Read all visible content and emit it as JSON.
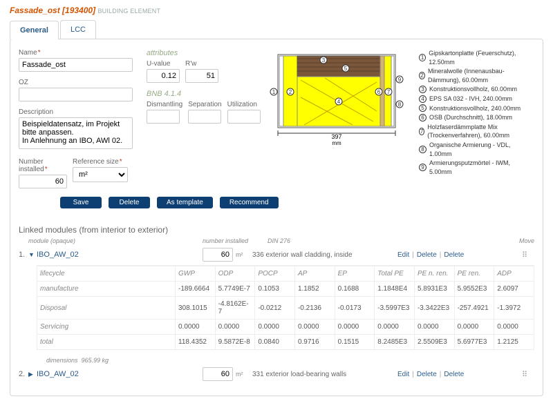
{
  "header": {
    "name": "Fassade_ost",
    "id": "[193400]",
    "type": "BUILDING ELEMENT"
  },
  "tabs": {
    "general": "General",
    "lcc": "LCC"
  },
  "form": {
    "name_label": "Name",
    "name_value": "Fassade_ost",
    "oz_label": "OZ",
    "oz_value": "",
    "desc_label": "Description",
    "desc_value": "Beispieldatensatz, im Projekt bitte anpassen.\nIn Anlehnung an IBO, AWl 02.",
    "num_label": "Number installed",
    "num_value": "60",
    "refsize_label": "Reference size",
    "refsize_value": "m²"
  },
  "attr": {
    "heading": "attributes",
    "uvalue_label": "U-value",
    "uvalue": "0.12",
    "rw_label": "R'w",
    "rw": "51",
    "bnb_head": "BNB 4.1.4",
    "dism_label": "Dismantling",
    "sep_label": "Separation",
    "util_label": "Utilization"
  },
  "fig": {
    "width_label": "397",
    "width_unit": "mm"
  },
  "legend": [
    "Gipskartonplatte (Feuerschutz), 12.50mm",
    "Mineralwolle (Innenausbau-Dämmung), 60.00mm",
    "Konstruktionsvollholz, 60.00mm",
    "EPS SA 032 - IVH, 240.00mm",
    "Konstruktionsvollholz, 240.00mm",
    "OSB (Durchschnitt), 18.00mm",
    "Holzfaserdämmplatte Mix (Trockenverfahren), 60.00mm",
    "Organische Armierung - VDL, 1.00mm",
    "Armierungsputzmörtel - IWM, 5.00mm"
  ],
  "buttons": {
    "save": "Save",
    "delete": "Delete",
    "astpl": "As template",
    "rec": "Recommend"
  },
  "linked": {
    "heading": "Linked modules (from interior to exterior)",
    "col_module": "module (opaque)",
    "col_num": "number installed",
    "col_din": "DIN 276",
    "col_move": "Move",
    "edit": "Edit",
    "delete": "Delete",
    "mods": [
      {
        "idx": "1.",
        "name": "IBO_AW_02",
        "num": "60",
        "unit": "m²",
        "din": "336  exterior wall cladding, inside",
        "open": true,
        "dims": "965.99 kg",
        "cols": [
          "GWP",
          "ODP",
          "POCP",
          "AP",
          "EP",
          "Total PE",
          "PE n. ren.",
          "PE ren.",
          "ADP"
        ],
        "rows": [
          {
            "l": "manufacture",
            "v": [
              "-189.6664",
              "5.7749E-7",
              "0.1053",
              "1.1852",
              "0.1688",
              "1.1848E4",
              "5.8931E3",
              "5.9552E3",
              "2.6097"
            ]
          },
          {
            "l": "Disposal",
            "v": [
              "308.1015",
              "-4.8162E-7",
              "-0.0212",
              "-0.2136",
              "-0.0173",
              "-3.5997E3",
              "-3.3422E3",
              "-257.4921",
              "-1.3972"
            ]
          },
          {
            "l": "Servicing",
            "v": [
              "0.0000",
              "0.0000",
              "0.0000",
              "0.0000",
              "0.0000",
              "0.0000",
              "0.0000",
              "0.0000",
              "0.0000"
            ]
          },
          {
            "l": "total",
            "v": [
              "118.4352",
              "9.5872E-8",
              "0.0840",
              "0.9716",
              "0.1515",
              "8.2485E3",
              "2.5509E3",
              "5.6977E3",
              "1.2125"
            ]
          }
        ]
      },
      {
        "idx": "2.",
        "name": "IBO_AW_02",
        "num": "60",
        "unit": "m²",
        "din": "331  exterior load-bearing walls",
        "open": false
      }
    ],
    "lifecycle_label": "lifecycle",
    "dimensions_label": "dimensions"
  }
}
